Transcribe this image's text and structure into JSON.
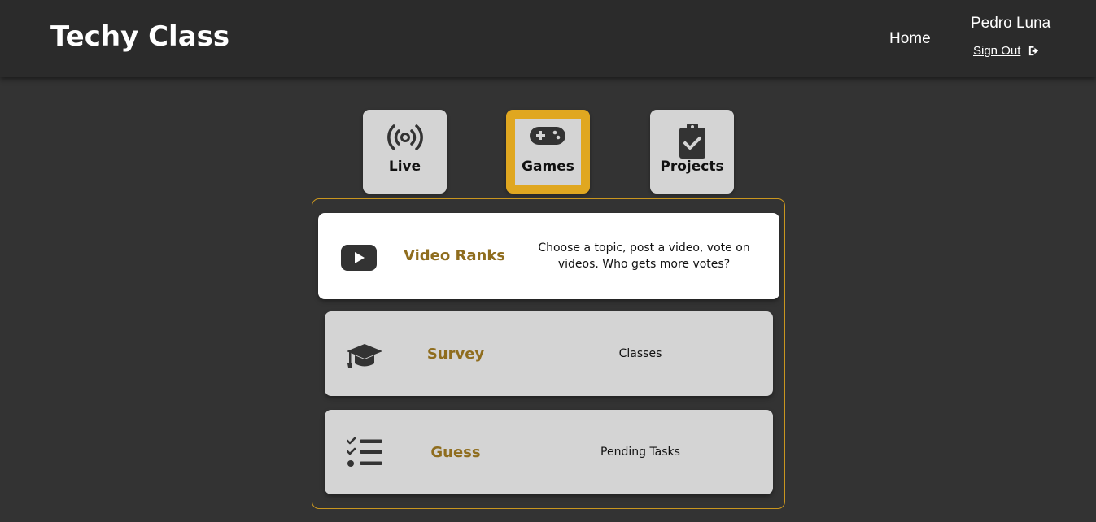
{
  "header": {
    "logo": "Techy Class",
    "nav_home": "Home",
    "user_name": "Pedro Luna",
    "sign_out": "Sign Out",
    "sign_out_icon": "sign-out-icon"
  },
  "tabs": [
    {
      "label": "Live",
      "icon": "broadcast-icon",
      "active": false
    },
    {
      "label": "Games",
      "icon": "gamepad-icon",
      "active": true
    },
    {
      "label": "Projects",
      "icon": "clipboard-check-icon",
      "active": false
    }
  ],
  "games": [
    {
      "title": "Video Ranks",
      "description": "Choose a topic, post a video, vote on videos. Who gets more votes?",
      "icon": "youtube-icon",
      "selected": true
    },
    {
      "title": "Survey",
      "description": "Classes",
      "icon": "graduation-cap-icon",
      "selected": false
    },
    {
      "title": "Guess",
      "description": "Pending Tasks",
      "icon": "task-list-icon",
      "selected": false
    }
  ],
  "colors": {
    "background": "#333333",
    "header": "#2b2b2b",
    "accent": "#e0a720",
    "title_gold": "#8f6d1e",
    "card": "#d4d4d4",
    "card_selected": "#ffffff"
  }
}
